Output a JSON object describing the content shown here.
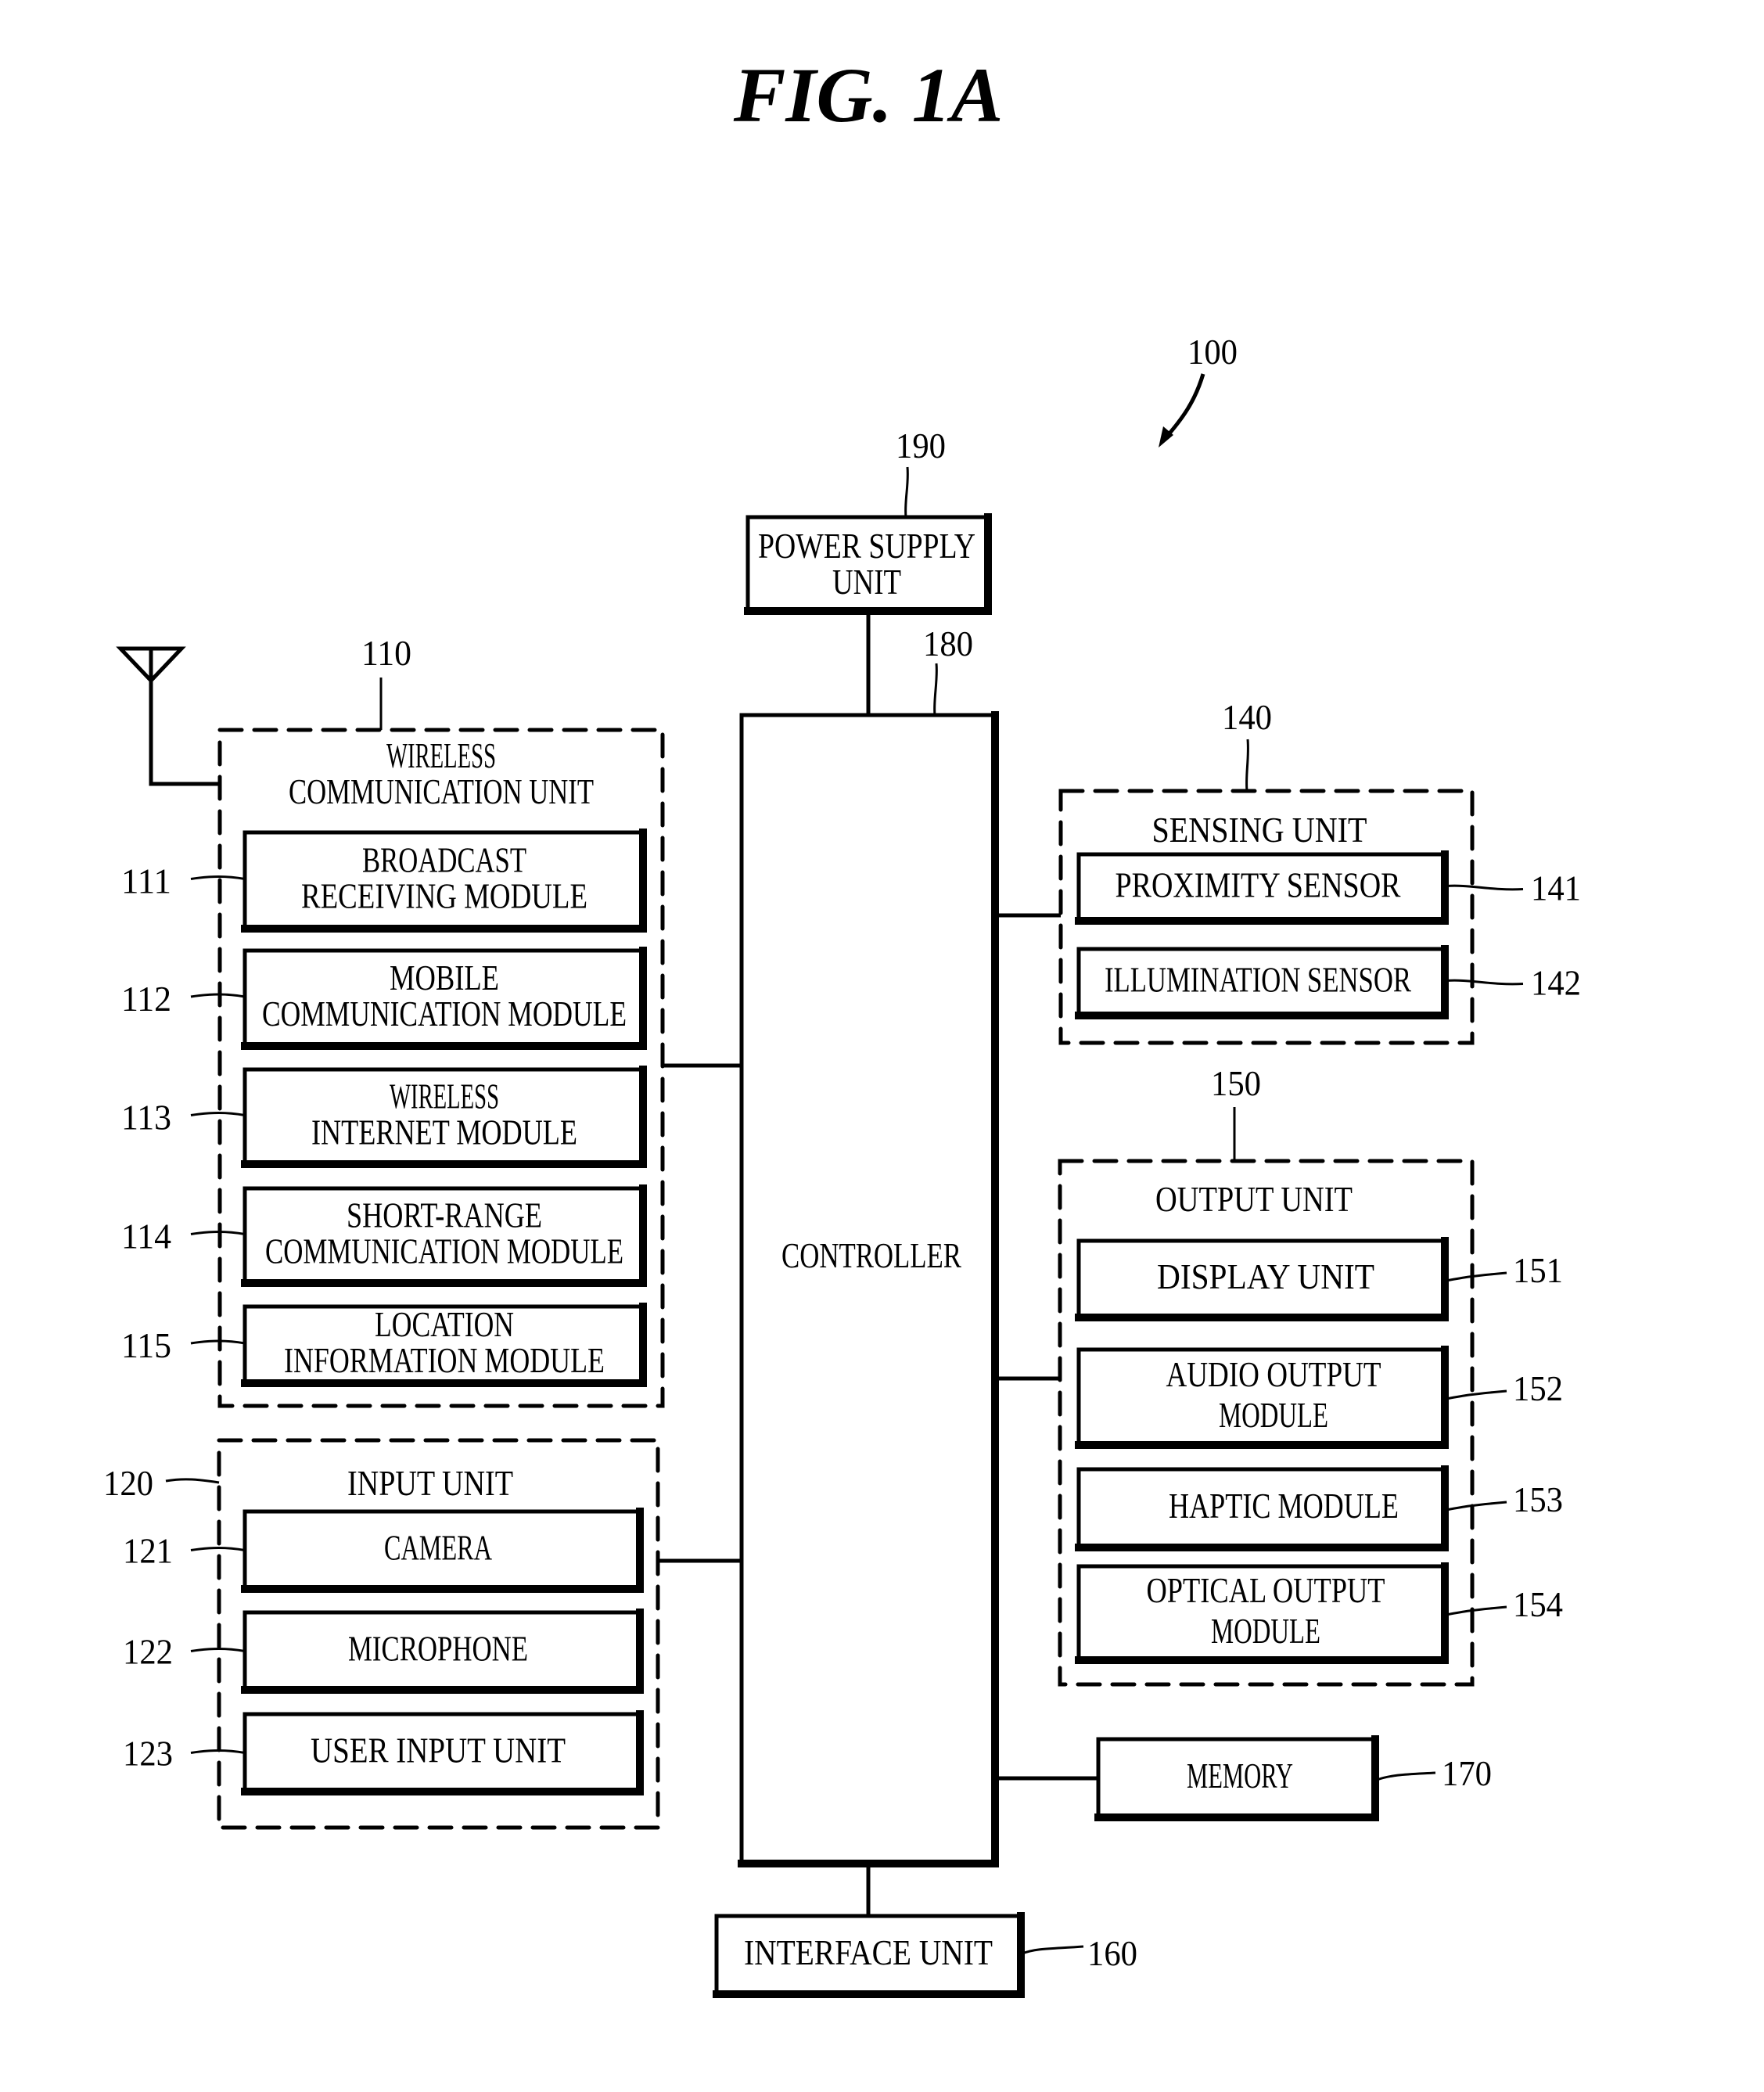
{
  "figure": {
    "title": "FIG. 1A",
    "device_ref": "100"
  },
  "power_supply": {
    "ref": "190",
    "lines": [
      "POWER SUPPLY",
      "UNIT"
    ]
  },
  "controller": {
    "ref": "180",
    "lines": [
      "CONTROLLER"
    ]
  },
  "wireless_unit": {
    "ref": "110",
    "lines": [
      "WIRELESS",
      "COMMUNICATION UNIT"
    ],
    "antenna_icon": "antenna-icon",
    "modules": [
      {
        "ref": "111",
        "lines": [
          "BROADCAST",
          "RECEIVING MODULE"
        ]
      },
      {
        "ref": "112",
        "lines": [
          "MOBILE",
          "COMMUNICATION MODULE"
        ]
      },
      {
        "ref": "113",
        "lines": [
          "WIRELESS",
          "INTERNET MODULE"
        ]
      },
      {
        "ref": "114",
        "lines": [
          "SHORT-RANGE",
          "COMMUNICATION MODULE"
        ]
      },
      {
        "ref": "115",
        "lines": [
          "LOCATION",
          "INFORMATION MODULE"
        ]
      }
    ]
  },
  "input_unit": {
    "ref": "120",
    "lines": [
      "INPUT UNIT"
    ],
    "modules": [
      {
        "ref": "121",
        "lines": [
          "CAMERA"
        ]
      },
      {
        "ref": "122",
        "lines": [
          "MICROPHONE"
        ]
      },
      {
        "ref": "123",
        "lines": [
          "USER INPUT UNIT"
        ]
      }
    ]
  },
  "sensing_unit": {
    "ref": "140",
    "lines": [
      "SENSING UNIT"
    ],
    "modules": [
      {
        "ref": "141",
        "lines": [
          "PROXIMITY SENSOR"
        ]
      },
      {
        "ref": "142",
        "lines": [
          "ILLUMINATION SENSOR"
        ]
      }
    ]
  },
  "output_unit": {
    "ref": "150",
    "lines": [
      "OUTPUT UNIT"
    ],
    "modules": [
      {
        "ref": "151",
        "lines": [
          "DISPLAY UNIT"
        ]
      },
      {
        "ref": "152",
        "lines": [
          "AUDIO OUTPUT",
          "MODULE"
        ]
      },
      {
        "ref": "153",
        "lines": [
          "HAPTIC MODULE"
        ]
      },
      {
        "ref": "154",
        "lines": [
          "OPTICAL OUTPUT",
          "MODULE"
        ]
      }
    ]
  },
  "memory": {
    "ref": "170",
    "lines": [
      "MEMORY"
    ]
  },
  "interface_unit": {
    "ref": "160",
    "lines": [
      "INTERFACE UNIT"
    ]
  }
}
